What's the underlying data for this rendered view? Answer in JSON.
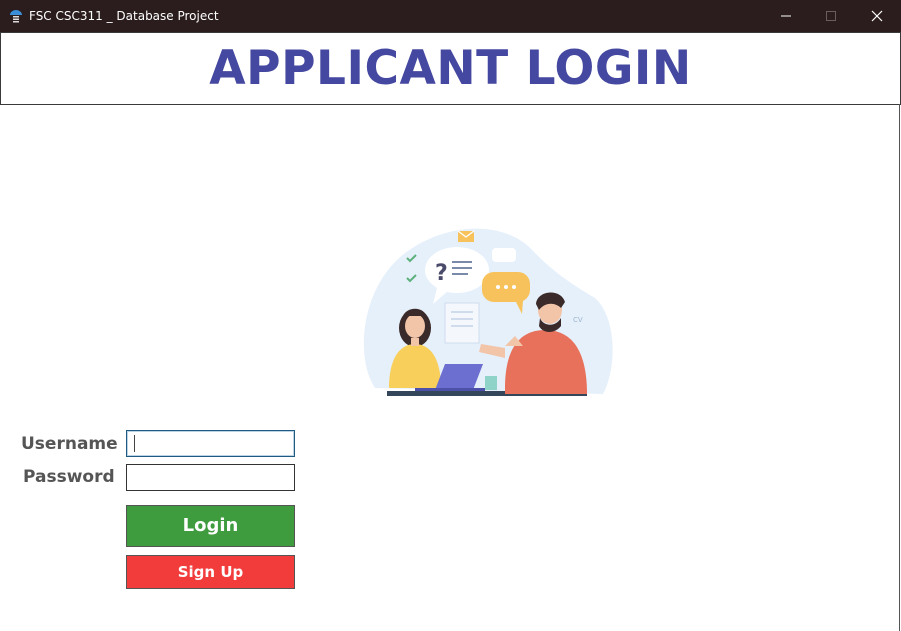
{
  "window": {
    "title": "FSC CSC311 _ Database Project",
    "controls": {
      "minimize": "minimize-icon",
      "maximize": "maximize-icon",
      "close": "close-icon"
    }
  },
  "header": {
    "title": "APPLICANT LOGIN",
    "color": "#4548a0"
  },
  "illustration": {
    "description_icon": "two-people-conversation-illustration"
  },
  "form": {
    "username_label": "Username",
    "username_value": "",
    "password_label": "Password",
    "password_value": "",
    "login_label": "Login",
    "signup_label": "Sign Up"
  },
  "colors": {
    "titlebar": "#2b1d1d",
    "login_button": "#3e9b3e",
    "signup_button": "#f23b3b",
    "label_text": "#555555"
  }
}
